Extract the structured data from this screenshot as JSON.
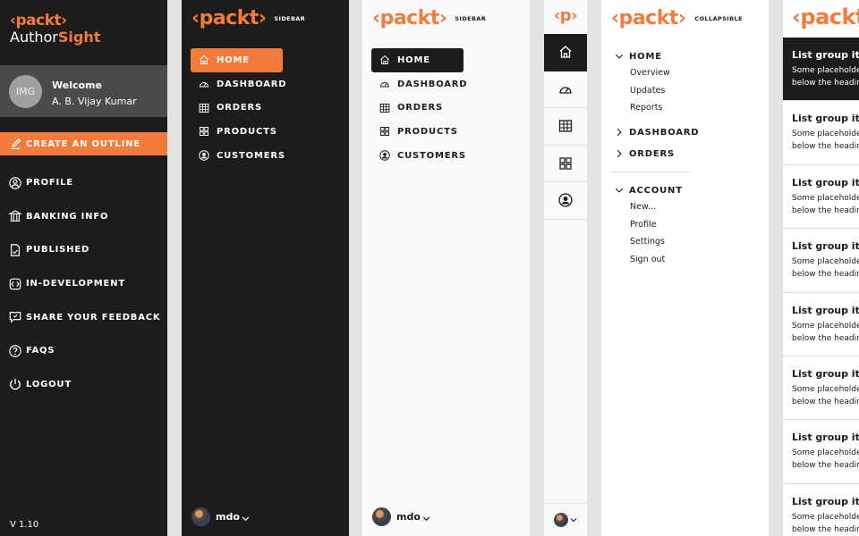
{
  "colors": {
    "accent": "#f47b3b",
    "dark": "#1c1c1c",
    "light": "#f8f9fa"
  },
  "logo_text": "‹packt›",
  "logo_small": "‹p›",
  "panel1": {
    "app_prefix": "Author",
    "app_suffix": "Sight",
    "avatar_text": "IMG",
    "welcome": "Welcome",
    "user_name": "A. B. Vijay Kumar",
    "cta": {
      "label": "CREATE AN OUTLINE",
      "icon": "edit-icon"
    },
    "menu": [
      {
        "label": "PROFILE",
        "icon": "user-circle-icon"
      },
      {
        "label": "BANKING INFO",
        "icon": "bank-icon"
      },
      {
        "label": "PUBLISHED",
        "icon": "document-icon"
      },
      {
        "label": "IN-DEVELOPMENT",
        "icon": "code-icon"
      },
      {
        "label": "SHARE YOUR FEEDBACK",
        "icon": "feedback-icon"
      },
      {
        "label": "FAQS",
        "icon": "question-icon"
      },
      {
        "label": "LOGOUT",
        "icon": "power-icon"
      }
    ],
    "version": "V 1.10"
  },
  "sidebar": {
    "subtitle": "SIDEBAR",
    "nav": [
      {
        "label": "HOME",
        "icon": "home-icon",
        "active": true
      },
      {
        "label": "DASHBOARD",
        "icon": "speedometer-icon"
      },
      {
        "label": "ORDERS",
        "icon": "table-icon"
      },
      {
        "label": "PRODUCTS",
        "icon": "grid-icon"
      },
      {
        "label": "CUSTOMERS",
        "icon": "person-circle-icon"
      }
    ],
    "user": "mdo"
  },
  "collapsible": {
    "subtitle": "COLLAPSIBLE",
    "home": {
      "label": "HOME",
      "items": [
        "Overview",
        "Updates",
        "Reports"
      ]
    },
    "dashboard": "DASHBOARD",
    "orders": "ORDERS",
    "account": {
      "label": "ACCOUNT",
      "items": [
        "New...",
        "Profile",
        "Settings",
        "Sign out"
      ]
    }
  },
  "list_group": {
    "item_title": "List group item heading",
    "item_desc_1": "Some placeholder content in a paragraph",
    "item_desc_2": "below the heading and date.",
    "count": 8
  }
}
